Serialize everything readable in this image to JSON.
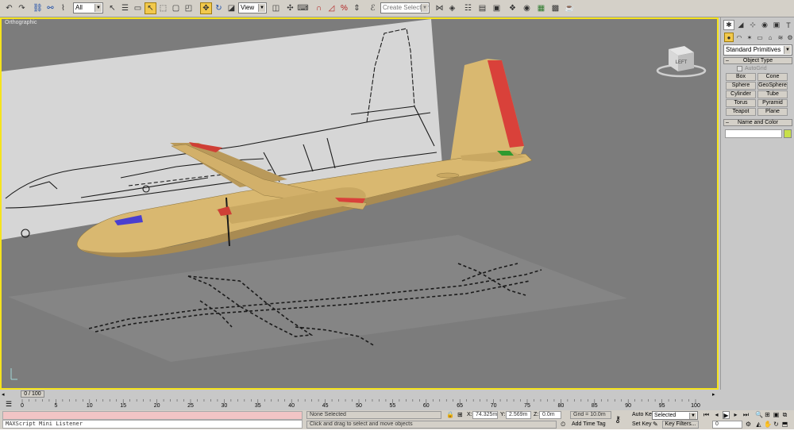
{
  "toolbar": {
    "selection_filter": "All",
    "reference_coord": "View",
    "named_selection_placeholder": "Create Selection Set"
  },
  "viewport": {
    "label": "Orthographic",
    "viewcube_face": "LEFT"
  },
  "command_panel": {
    "category": "Standard Primitives",
    "object_type_title": "Object Type",
    "autogrid_label": "AutoGrid",
    "primitives": [
      "Box",
      "Cone",
      "Sphere",
      "GeoSphere",
      "Cylinder",
      "Tube",
      "Torus",
      "Pyramid",
      "Teapot",
      "Plane"
    ],
    "name_color_title": "Name and Color",
    "object_name": "",
    "object_color": "#c8e04a"
  },
  "time_slider": {
    "frame_text": "0 / 100"
  },
  "trackbar": {
    "ticks": [
      "0",
      "5",
      "10",
      "15",
      "20",
      "25",
      "30",
      "35",
      "40",
      "45",
      "50",
      "55",
      "60",
      "65",
      "70",
      "75",
      "80",
      "85",
      "90",
      "95",
      "100"
    ]
  },
  "status": {
    "maxscript_text": "MAXScript Mini Listener",
    "selection": "None Selected",
    "prompt": "Click and drag to select and move objects",
    "x_label": "X:",
    "x_value": "74.325m",
    "y_label": "Y:",
    "y_value": "2.569m",
    "z_label": "Z:",
    "z_value": "0.0m",
    "grid": "Grid = 10.0m",
    "add_time_tag": "Add Time Tag",
    "auto_key": "Auto Key",
    "set_key": "Set Key",
    "key_mode": "Selected",
    "key_filters": "Key Filters...",
    "current_frame": "0"
  },
  "colors": {
    "viewport_bg": "#7c7c7c",
    "active_border": "#f5e31d",
    "aircraft_body": "#d9b870",
    "tail_red": "#d9413a",
    "cockpit_blue": "#4a3fcf",
    "ui_gray": "#d4d0c8",
    "maxscript_pink": "#f2c5c5"
  }
}
